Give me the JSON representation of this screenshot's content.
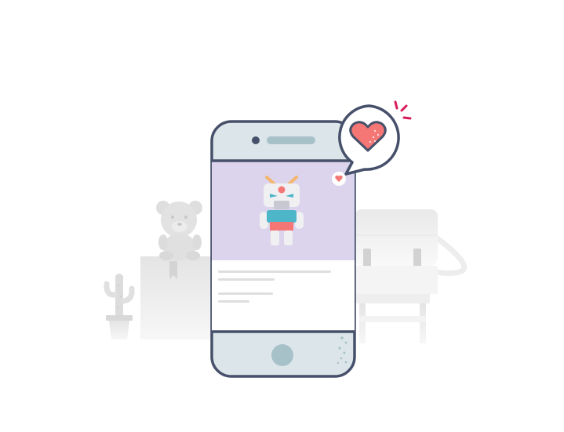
{
  "colors": {
    "outline": "#46506a",
    "phone_body": "#dce6ea",
    "speaker": "#a7c1c9",
    "product_bg": "#dcd3ec",
    "heart": "#f57775",
    "sparkle": "#d81b5a",
    "text_lines": "#dedede"
  },
  "product": {
    "image": "robot-toy-icon",
    "liked": true
  },
  "background_items": [
    "cactus-icon",
    "teddy-bear-icon",
    "satchel-bag-icon"
  ]
}
